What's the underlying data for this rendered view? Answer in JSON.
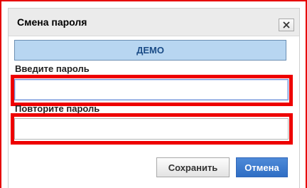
{
  "dialog": {
    "title": "Смена пароля",
    "close_icon": "close-icon",
    "demo_label": "ДЕМО",
    "password_label": "Введите пароль",
    "password_value": "",
    "confirm_label": "Повторите пароль",
    "confirm_value": "",
    "save_label": "Сохранить",
    "cancel_label": "Отмена"
  },
  "colors": {
    "highlight": "#ee0000",
    "demo_bg": "#b8d6f1",
    "demo_text": "#1a4b86",
    "primary_button": "#2f6ec4"
  }
}
